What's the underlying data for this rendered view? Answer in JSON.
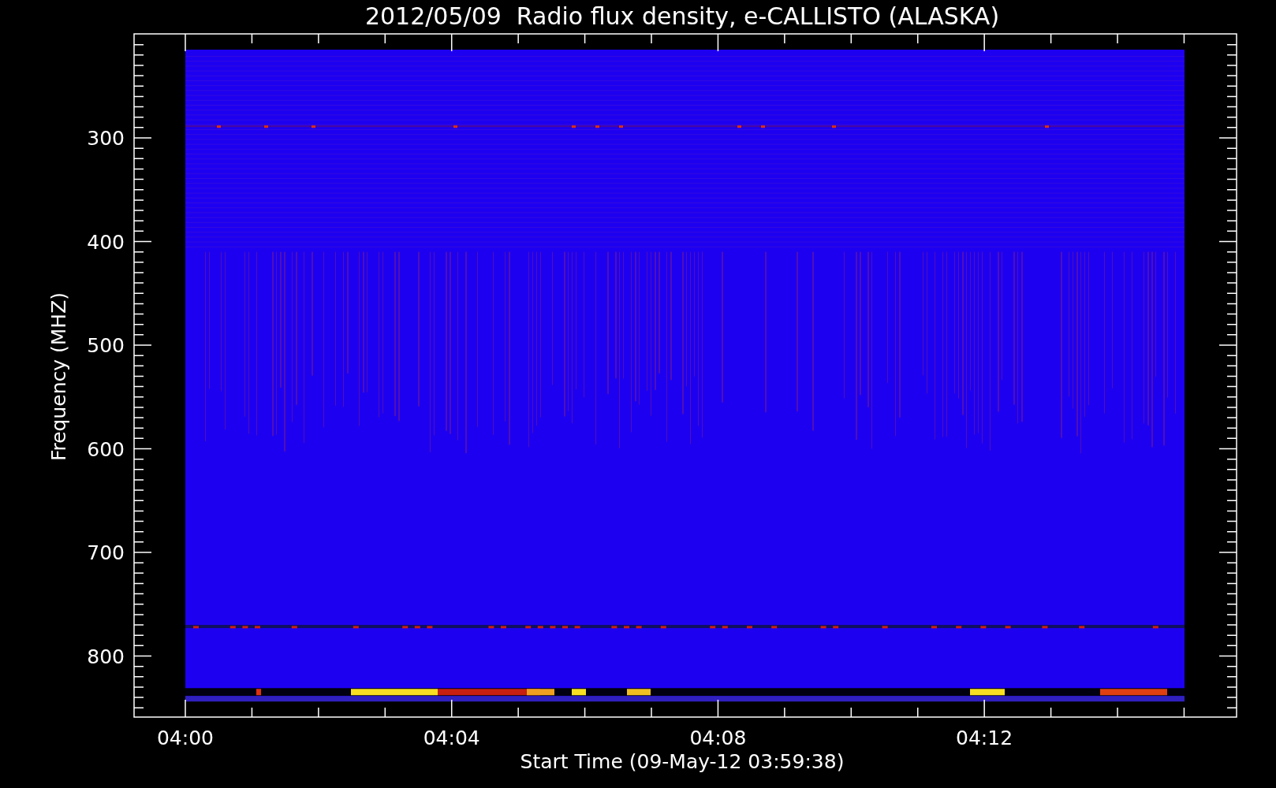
{
  "title": "2012/05/09  Radio flux density, e-CALLISTO (ALASKA)",
  "y_axis": {
    "label": "Frequency (MHZ)",
    "ticks": [
      "300",
      "400",
      "500",
      "600",
      "700",
      "800"
    ]
  },
  "x_axis": {
    "label": "Start Time (09-May-12 03:59:38)",
    "ticks": [
      "04:00",
      "04:04",
      "04:08",
      "04:12"
    ]
  }
}
